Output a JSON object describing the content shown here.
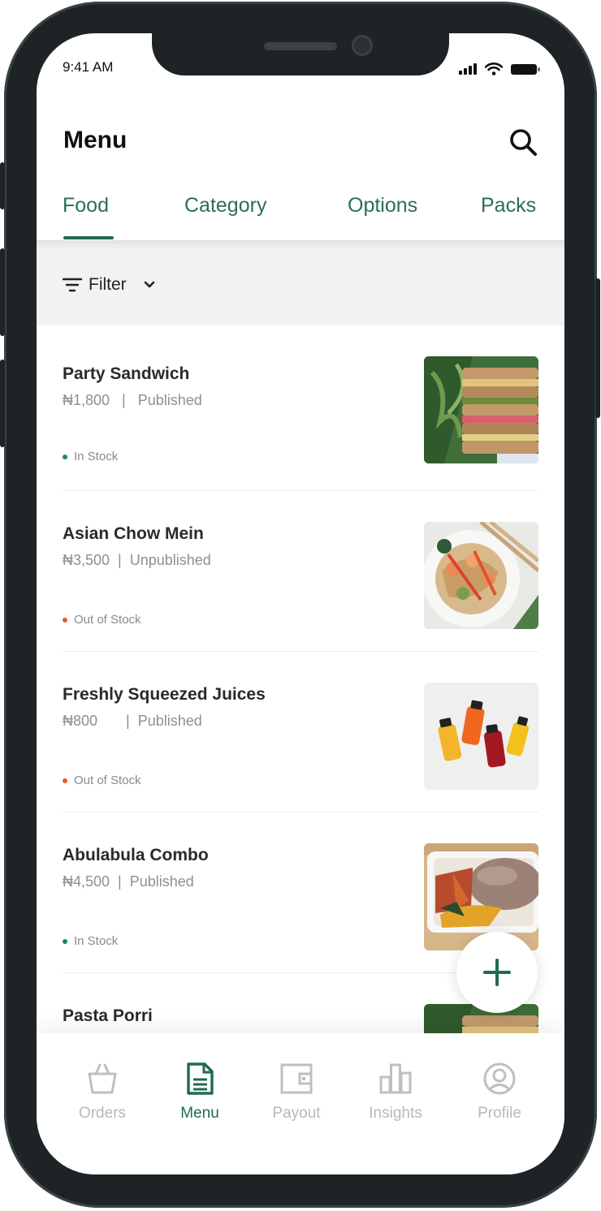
{
  "status_bar": {
    "time": "9:41 AM"
  },
  "header": {
    "title": "Menu",
    "search_icon": "search-icon"
  },
  "tabs": [
    {
      "label": "Food",
      "active": true
    },
    {
      "label": "Category",
      "active": false
    },
    {
      "label": "Options",
      "active": false
    },
    {
      "label": "Packs",
      "active": false
    }
  ],
  "filter": {
    "label": "Filter",
    "icon": "filter-icon"
  },
  "items": [
    {
      "name": "Party Sandwich",
      "price": "₦1,800",
      "status": "Published",
      "stock": "In Stock",
      "stock_color": "#1a8a5a"
    },
    {
      "name": "Asian Chow Mein",
      "price": "₦3,500",
      "status": "Unpublished",
      "stock": "Out of Stock",
      "stock_color": "#e8572b"
    },
    {
      "name": "Freshly Squeezed Juices",
      "price": "₦800",
      "status": "Published",
      "stock": "Out of Stock",
      "stock_color": "#e8572b"
    },
    {
      "name": "Abulabula Combo",
      "price": "₦4,500",
      "status": "Published",
      "stock": "In Stock",
      "stock_color": "#1a8a5a"
    },
    {
      "name": "Pasta Porri"
    }
  ],
  "fab": {
    "icon": "plus-icon"
  },
  "bottom_nav": [
    {
      "label": "Orders",
      "icon": "bag-icon",
      "active": false
    },
    {
      "label": "Menu",
      "icon": "document-icon",
      "active": true
    },
    {
      "label": "Payout",
      "icon": "wallet-icon",
      "active": false
    },
    {
      "label": "Insights",
      "icon": "chart-icon",
      "active": false
    },
    {
      "label": "Profile",
      "icon": "profile-icon",
      "active": false
    }
  ],
  "colors": {
    "brand": "#1f6b52",
    "tab_text": "#2d6e58",
    "inactive_nav": "#b9b9b9",
    "frame": "#1e2426"
  }
}
